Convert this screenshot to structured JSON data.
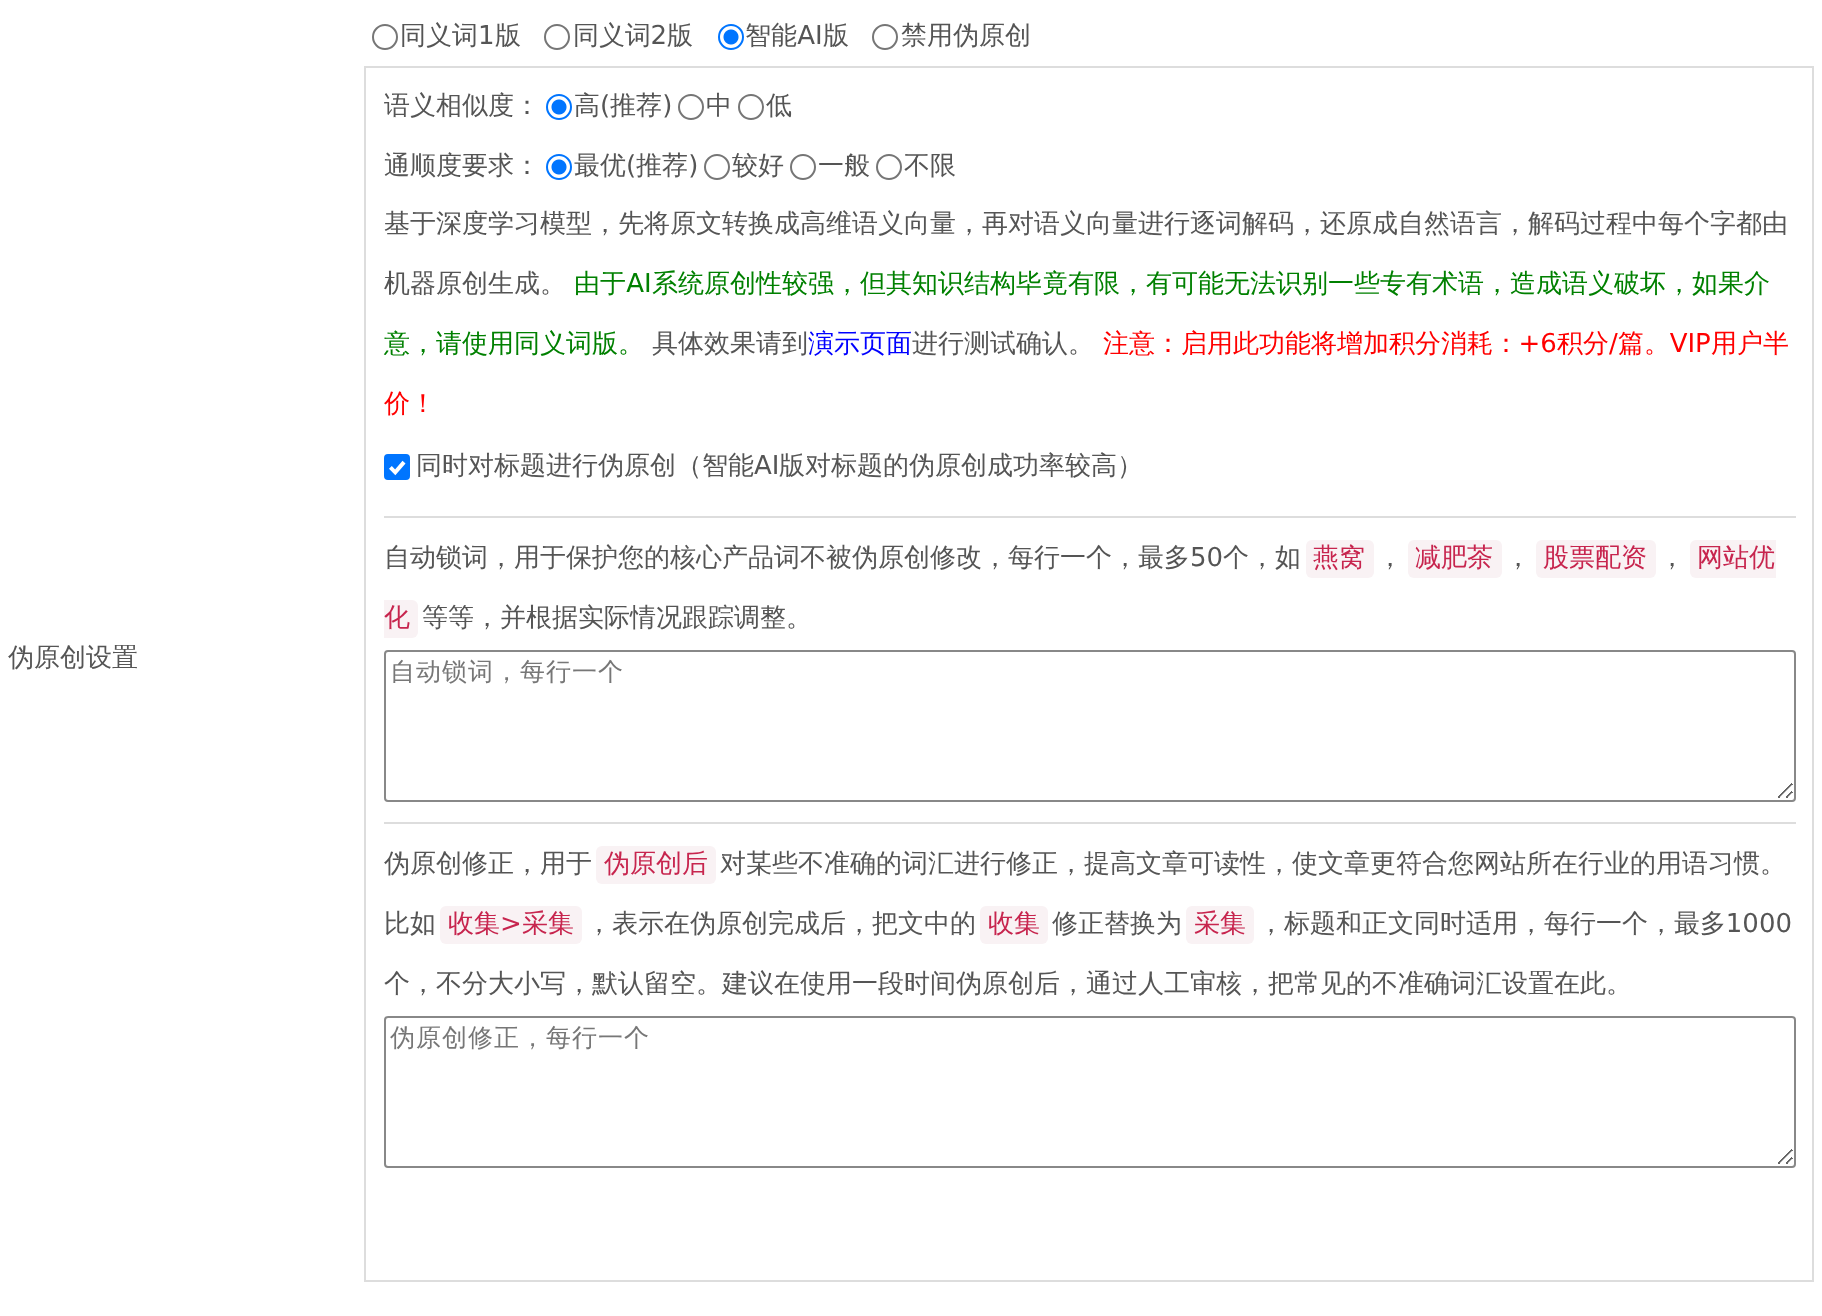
{
  "section_label": "伪原创设置",
  "modes": [
    {
      "label": "同义词1版",
      "selected": false
    },
    {
      "label": "同义词2版",
      "selected": false
    },
    {
      "label": "智能AI版",
      "selected": true
    },
    {
      "label": "禁用伪原创",
      "selected": false
    }
  ],
  "settings": [
    {
      "label": "语义相似度：",
      "options": [
        {
          "label": "高(推荐)",
          "selected": true
        },
        {
          "label": "中",
          "selected": false
        },
        {
          "label": "低",
          "selected": false
        }
      ]
    },
    {
      "label": "通顺度要求：",
      "options": [
        {
          "label": "最优(推荐)",
          "selected": true
        },
        {
          "label": "较好",
          "selected": false
        },
        {
          "label": "一般",
          "selected": false
        },
        {
          "label": "不限",
          "selected": false
        }
      ]
    }
  ],
  "description": [
    {
      "kind": "text",
      "text": "基于深度学习模型，先将原文转换成高维语义向量，再对语义向量进行逐词解码，还原成自然语言，解码过程中每个字都由机器原创生成。 "
    },
    {
      "kind": "notice",
      "text": "由于AI系统原创性较强，但其知识结构毕竟有限，有可能无法识别一些专有术语，造成语义破坏，如果介意，请使用同义词版。"
    },
    {
      "kind": "text",
      "text": " 具体效果请到"
    },
    {
      "kind": "link",
      "text": "演示页面"
    },
    {
      "kind": "text",
      "text": "进行测试确认。 "
    },
    {
      "kind": "warning",
      "text": "注意：启用此功能将增加积分消耗：+6积分/篇。VIP用户半价！"
    }
  ],
  "title_option": {
    "label": "同时对标题进行伪原创（智能AI版对标题的伪原创成功率较高）",
    "checked": true
  },
  "lock_words": {
    "help": [
      {
        "kind": "text",
        "text": "自动锁词，用于保护您的核心产品词不被伪原创修改，每行一个，最多50个，如"
      },
      {
        "kind": "code",
        "text": "燕窝"
      },
      {
        "kind": "text",
        "text": "，"
      },
      {
        "kind": "code",
        "text": "减肥茶"
      },
      {
        "kind": "text",
        "text": "，"
      },
      {
        "kind": "code",
        "text": "股票配资"
      },
      {
        "kind": "text",
        "text": "，"
      },
      {
        "kind": "code",
        "text": "网站优化"
      },
      {
        "kind": "text",
        "text": "等等，并根据实际情况跟踪调整。"
      }
    ],
    "placeholder": "自动锁词，每行一个"
  },
  "corrections": {
    "help": [
      {
        "kind": "text",
        "text": "伪原创修正，用于"
      },
      {
        "kind": "code",
        "text": "伪原创后"
      },
      {
        "kind": "text",
        "text": "对某些不准确的词汇进行修正，提高文章可读性，使文章更符合您网站所在行业的用语习惯。比如"
      },
      {
        "kind": "code",
        "text": "收集>采集"
      },
      {
        "kind": "text",
        "text": "，表示在伪原创完成后，把文中的"
      },
      {
        "kind": "code",
        "text": "收集"
      },
      {
        "kind": "text",
        "text": "修正替换为"
      },
      {
        "kind": "code",
        "text": "采集"
      },
      {
        "kind": "text",
        "text": "，标题和正文同时适用，每行一个，最多1000个，不分大小写，默认留空。建议在使用一段时间伪原创后，通过人工审核，把常见的不准确词汇设置在此。"
      }
    ],
    "placeholder": "伪原创修正，每行一个"
  }
}
